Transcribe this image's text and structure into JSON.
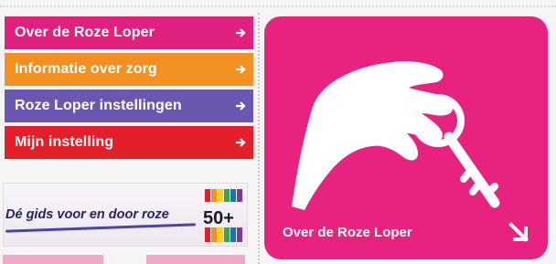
{
  "menu": {
    "items": [
      {
        "label": "Over de Roze Loper",
        "color": "#e0217e"
      },
      {
        "label": "Informatie over zorg",
        "color": "#f39022"
      },
      {
        "label": "Roze Loper instellingen",
        "color": "#6a58b0"
      },
      {
        "label": "Mijn instelling",
        "color": "#e31f2a"
      }
    ],
    "arrow_icon": "arrow-right-icon"
  },
  "banner": {
    "text": "Dé gids voor en door roze",
    "badge": "50+"
  },
  "card": {
    "title": "Over de Roze Loper",
    "color": "#e8237f",
    "illustration_icon": "hand-holding-key-icon",
    "arrow_icon": "arrow-down-right-icon"
  }
}
